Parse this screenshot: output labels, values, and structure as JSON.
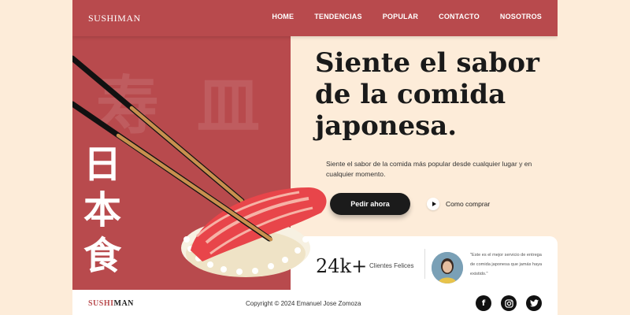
{
  "brand": {
    "logo": "SUSHIMAN",
    "footer_logo_a": "SUSHI",
    "footer_logo_b": "MAN"
  },
  "nav": {
    "items": [
      "HOME",
      "TENDENCIAS",
      "POPULAR",
      "CONTACTO",
      "NOSOTROS"
    ]
  },
  "decor": {
    "kanji_vertical": [
      "日",
      "本",
      "食"
    ],
    "kanji_bg": "寿 皿"
  },
  "hero": {
    "headline_lines": [
      "Siente el sabor",
      "de la comida",
      "japonesa."
    ],
    "subtitle": "Siente el sabor de la comida más popular desde cualquier lugar y en cualquier momento.",
    "cta_label": "Pedir ahora",
    "howto_label": "Como comprar"
  },
  "stats": {
    "number": "24k+",
    "label": "Clientes Felices",
    "quote": "\"Este es el mejor servicio de entrega de comida japonesa que jamás haya existido.\""
  },
  "footer": {
    "copyright": "Copyright © 2024 Emanuel Jose Zomoza"
  },
  "social": [
    "facebook-icon",
    "instagram-icon",
    "twitter-icon"
  ],
  "colors": {
    "brand_red": "#b84a4d",
    "background": "#fdecd9",
    "dark": "#1b1b1b"
  }
}
